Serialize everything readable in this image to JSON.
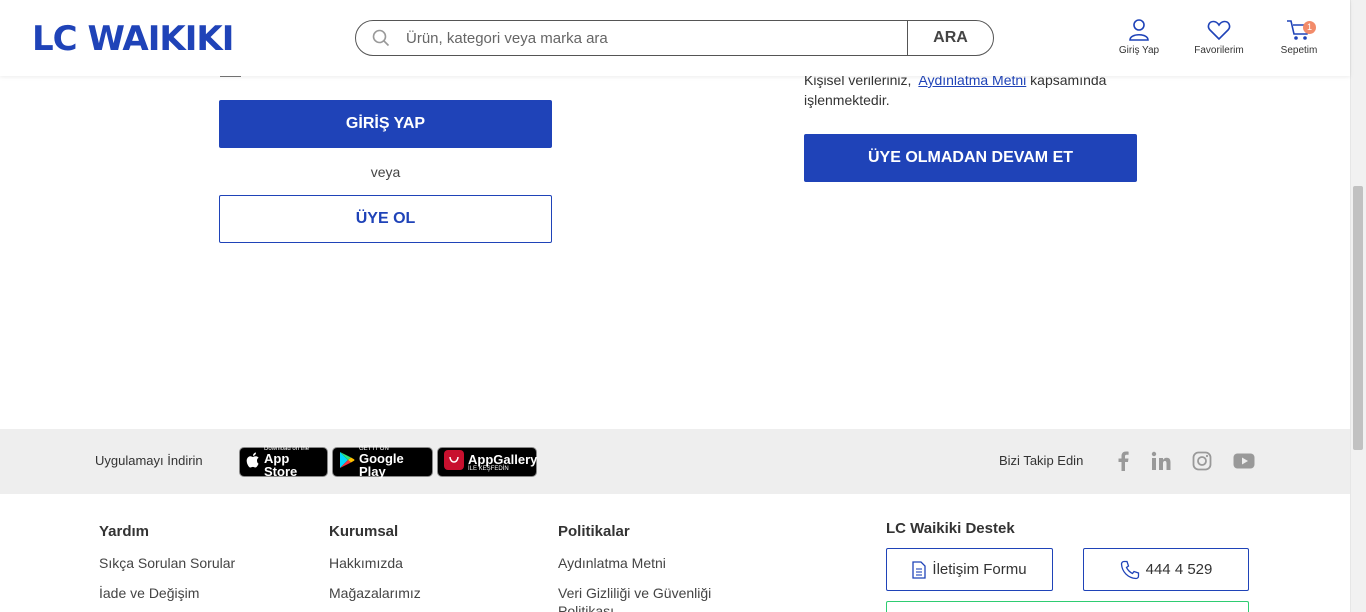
{
  "header": {
    "logo": "LC WAIKIKI",
    "search_placeholder": "Ürün, kategori veya marka ara",
    "search_button": "ARA",
    "actions": {
      "login": "Giriş Yap",
      "favorites": "Favorilerim",
      "cart": "Sepetim",
      "cart_count": "1"
    }
  },
  "login": {
    "login_button": "GİRİŞ YAP",
    "or_text": "veya",
    "register_button": "ÜYE OL"
  },
  "guest": {
    "kvkk_prefix": "Kişisel verileriniz,",
    "kvkk_link": "Aydınlatma Metni",
    "kvkk_suffix": "kapsamında işlenmektedir.",
    "guest_button": "ÜYE OLMADAN DEVAM ET"
  },
  "app_band": {
    "download_label": "Uygulamayı İndirin",
    "app_store": {
      "small": "Download on the",
      "big": "App Store"
    },
    "google_play": {
      "small": "GET IT ON",
      "big": "Google Play"
    },
    "app_gallery": {
      "small": "İLE KEŞFEDİN",
      "big": "AppGallery"
    },
    "follow_label": "Bizi Takip Edin"
  },
  "footer": {
    "columns": [
      {
        "title": "Yardım",
        "links": [
          "Sıkça Sorulan Sorular",
          "İade ve Değişim"
        ]
      },
      {
        "title": "Kurumsal",
        "links": [
          "Hakkımızda",
          "Mağazalarımız"
        ]
      },
      {
        "title": "Politikalar",
        "links": [
          "Aydınlatma Metni",
          "Veri Gizliliği ve Güvenliği Politikası"
        ]
      }
    ],
    "support": {
      "title": "LC Waikiki Destek",
      "contact_form": "İletişim Formu",
      "phone": "444 4 529"
    }
  },
  "colors": {
    "brand": "#1f43b8",
    "band_bg": "#eeeeee",
    "whatsapp_green": "#2ecc71"
  }
}
